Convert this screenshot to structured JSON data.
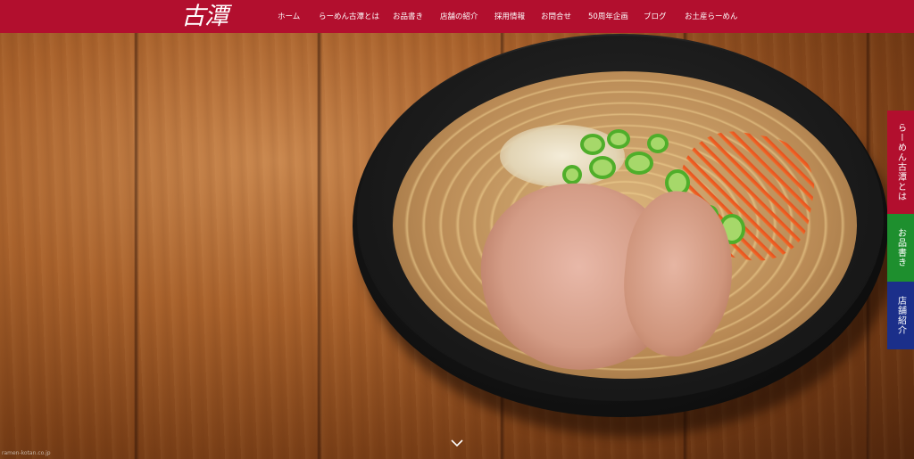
{
  "header": {
    "logo_text": "古潭",
    "nav": [
      "ホーム",
      "らーめん古潭とは",
      "お品書き",
      "店舗の紹介",
      "採用情報",
      "お問合せ",
      "50周年企画",
      "ブログ",
      "お土産らーめん"
    ]
  },
  "side_tabs": [
    {
      "label": "らーめん古潭とは",
      "color": "#b20f2e"
    },
    {
      "label": "お品書き",
      "color": "#1e8f2e"
    },
    {
      "label": "店舗紹介",
      "color": "#1b2f8a"
    }
  ],
  "scroll_hint_icon": "chevron-down-icon",
  "watermark": "ramen-kotan.co.jp",
  "colors": {
    "header_bg": "#b20f2e"
  }
}
